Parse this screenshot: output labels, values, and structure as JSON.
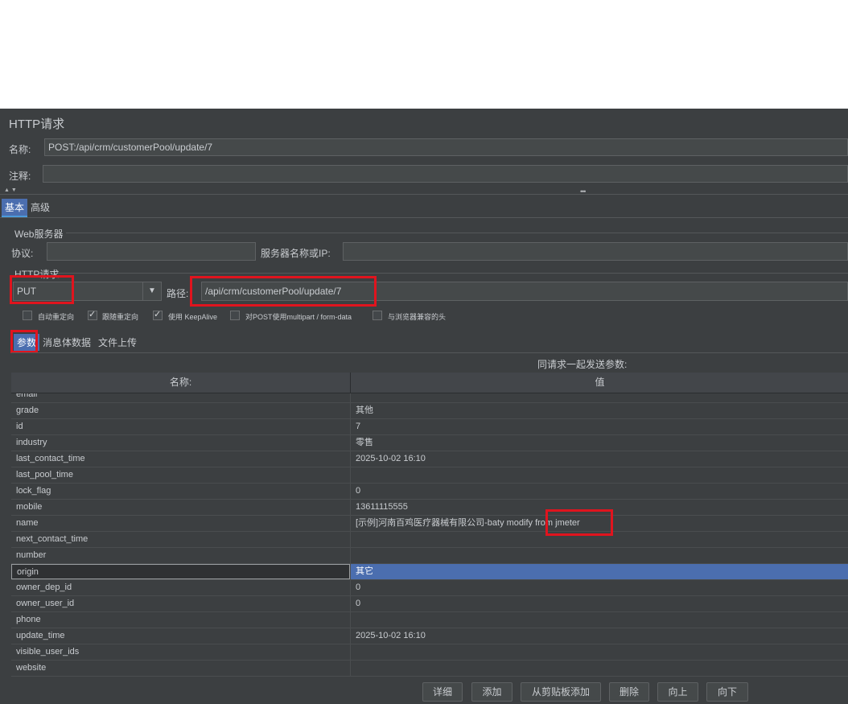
{
  "panel": {
    "title": "HTTP请求",
    "name_label": "名称:",
    "name_value": "POST:/api/crm/customerPool/update/7",
    "comment_label": "注释:",
    "comment_value": ""
  },
  "tabs": {
    "basic": "基本",
    "advanced": "高级"
  },
  "web_server": {
    "legend": "Web服务器",
    "protocol_label": "协议:",
    "protocol_value": "",
    "server_label": "服务器名称或IP:",
    "server_value": ""
  },
  "http_request": {
    "legend": "HTTP请求",
    "method": "PUT",
    "path_label": "路径:",
    "path_value": "/api/crm/customerPool/update/7"
  },
  "options": [
    {
      "label": "自动重定向",
      "checked": false
    },
    {
      "label": "跟随重定向",
      "checked": true
    },
    {
      "label": "使用 KeepAlive",
      "checked": true
    },
    {
      "label": "对POST使用multipart / form-data",
      "checked": false
    },
    {
      "label": "与浏览器兼容的头",
      "checked": false
    }
  ],
  "subtabs": {
    "params": "参数",
    "body": "消息体数据",
    "files": "文件上传"
  },
  "params_table": {
    "caption": "同请求一起发送参数:",
    "col_name": "名称:",
    "col_value": "值",
    "rows": [
      {
        "name": "email",
        "value": ""
      },
      {
        "name": "grade",
        "value": "其他"
      },
      {
        "name": "id",
        "value": "7"
      },
      {
        "name": "industry",
        "value": "零售"
      },
      {
        "name": "last_contact_time",
        "value": "2025-10-02 16:10"
      },
      {
        "name": "last_pool_time",
        "value": ""
      },
      {
        "name": "lock_flag",
        "value": "0"
      },
      {
        "name": "mobile",
        "value": "13611115555"
      },
      {
        "name": "name",
        "value": "[示例]河南百鸡医疗器械有限公司-baty modify from jmeter"
      },
      {
        "name": "next_contact_time",
        "value": ""
      },
      {
        "name": "number",
        "value": ""
      },
      {
        "name": "origin",
        "value": "其它"
      },
      {
        "name": "owner_dep_id",
        "value": "0"
      },
      {
        "name": "owner_user_id",
        "value": "0"
      },
      {
        "name": "phone",
        "value": ""
      },
      {
        "name": "update_time",
        "value": "2025-10-02 16:10"
      },
      {
        "name": "visible_user_ids",
        "value": ""
      },
      {
        "name": "website",
        "value": ""
      }
    ],
    "selected_row": "origin"
  },
  "buttons": {
    "detail": "详细",
    "add": "添加",
    "add_clipboard": "从剪贴板添加",
    "delete": "删除",
    "up": "向上",
    "down": "向下"
  },
  "colors": {
    "panel_bg": "#3c3f41",
    "highlight": "#e0141e",
    "selection": "#4b6eaf"
  }
}
